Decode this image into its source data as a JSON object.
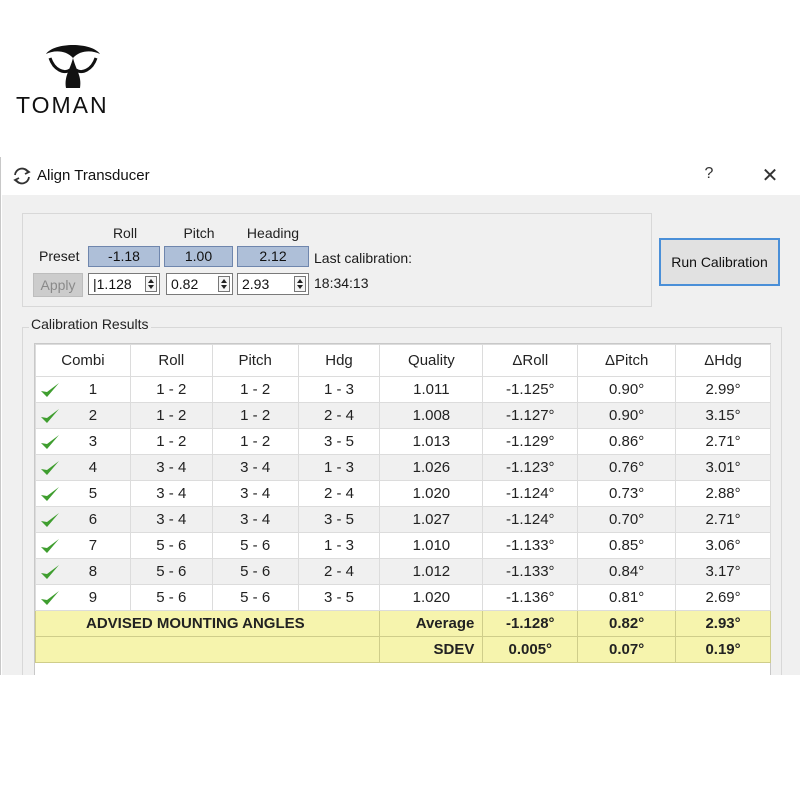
{
  "logo": {
    "text": "TOMAN"
  },
  "window": {
    "title": "Align Transducer",
    "help_label": "?",
    "close_label": "✕"
  },
  "preset": {
    "headers": {
      "roll": "Roll",
      "pitch": "Pitch",
      "heading": "Heading"
    },
    "label": "Preset",
    "values": {
      "roll": "-1.18",
      "pitch": "1.00",
      "heading": "2.12"
    },
    "inputs": {
      "roll": "1.128",
      "pitch": "0.82",
      "heading": "2.93"
    },
    "apply_label": "Apply",
    "last_calibration_label": "Last calibration:",
    "last_calibration_time": "18:34:13"
  },
  "run_calibration_label": "Run Calibration",
  "results": {
    "group_label": "Calibration Results",
    "columns": [
      "Combi",
      "Roll",
      "Pitch",
      "Hdg",
      "Quality",
      "ΔRoll",
      "ΔPitch",
      "ΔHdg"
    ],
    "rows": [
      [
        "1",
        "1 - 2",
        "1 - 2",
        "1 - 3",
        "1.011",
        "-1.125°",
        "0.90°",
        "2.99°"
      ],
      [
        "2",
        "1 - 2",
        "1 - 2",
        "2 - 4",
        "1.008",
        "-1.127°",
        "0.90°",
        "3.15°"
      ],
      [
        "3",
        "1 - 2",
        "1 - 2",
        "3 - 5",
        "1.013",
        "-1.129°",
        "0.86°",
        "2.71°"
      ],
      [
        "4",
        "3 - 4",
        "3 - 4",
        "1 - 3",
        "1.026",
        "-1.123°",
        "0.76°",
        "3.01°"
      ],
      [
        "5",
        "3 - 4",
        "3 - 4",
        "2 - 4",
        "1.020",
        "-1.124°",
        "0.73°",
        "2.88°"
      ],
      [
        "6",
        "3 - 4",
        "3 - 4",
        "3 - 5",
        "1.027",
        "-1.124°",
        "0.70°",
        "2.71°"
      ],
      [
        "7",
        "5 - 6",
        "5 - 6",
        "1 - 3",
        "1.010",
        "-1.133°",
        "0.85°",
        "3.06°"
      ],
      [
        "8",
        "5 - 6",
        "5 - 6",
        "2 - 4",
        "1.012",
        "-1.133°",
        "0.84°",
        "3.17°"
      ],
      [
        "9",
        "5 - 6",
        "5 - 6",
        "3 - 5",
        "1.020",
        "-1.136°",
        "0.81°",
        "2.69°"
      ]
    ],
    "advised_label": "ADVISED MOUNTING ANGLES",
    "average": {
      "label": "Average",
      "roll": "-1.128°",
      "pitch": "0.82°",
      "hdg": "2.93°"
    },
    "sdev": {
      "label": "SDEV",
      "roll": "0.005°",
      "pitch": "0.07°",
      "hdg": "0.19°"
    }
  },
  "colors": {
    "check": "#3f9e2f",
    "summary": "#f6f4ad",
    "preset_value": "#aebfd8",
    "focus_border": "#4a8fd8"
  },
  "icons": {
    "title": "refresh-icon",
    "row_status": "checkmark-icon"
  }
}
